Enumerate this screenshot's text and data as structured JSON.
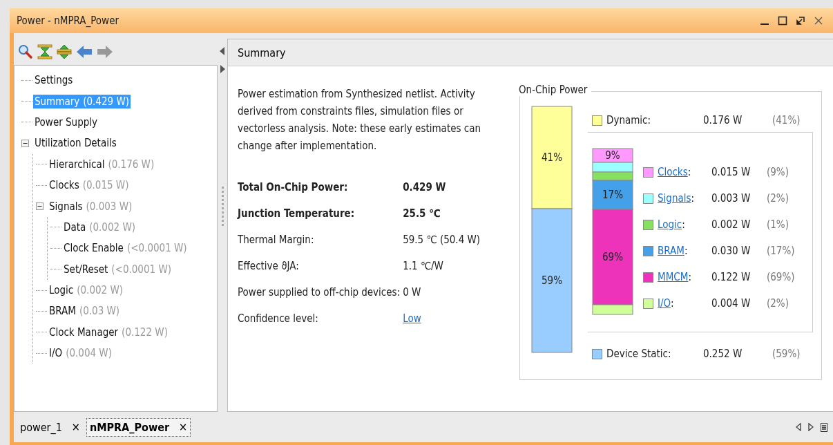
{
  "window": {
    "title": "Power - nMPRA_Power"
  },
  "tree": [
    {
      "label": "Settings",
      "selected": false
    },
    {
      "label": "Summary",
      "value": "(0.429 W)",
      "selected": true
    },
    {
      "label": "Power Supply",
      "selected": false
    },
    {
      "label": "Utilization Details",
      "selected": false,
      "expanded": true,
      "children": [
        {
          "label": "Hierarchical",
          "value": "(0.176 W)",
          "selected": false
        },
        {
          "label": "Clocks",
          "value": "(0.015 W)",
          "selected": false
        },
        {
          "label": "Signals",
          "value": "(0.003 W)",
          "selected": false,
          "expanded": true,
          "children": [
            {
              "label": "Data",
              "value": "(0.002 W)",
              "selected": false
            },
            {
              "label": "Clock Enable",
              "value": "(<0.0001 W)",
              "selected": false
            },
            {
              "label": "Set/Reset",
              "value": "(<0.0001 W)",
              "selected": false
            }
          ]
        },
        {
          "label": "Logic",
          "value": "(0.002 W)",
          "selected": false
        },
        {
          "label": "BRAM",
          "value": "(0.03 W)",
          "selected": false
        },
        {
          "label": "Clock Manager",
          "value": "(0.122 W)",
          "selected": false
        },
        {
          "label": "I/O",
          "value": "(0.004 W)",
          "selected": false
        }
      ]
    }
  ],
  "panel": {
    "title": "Summary",
    "description": "Power estimation from Synthesized netlist. Activity derived from constraints files, simulation files or vectorless analysis. Note: these early estimates can change after implementation.",
    "properties": [
      {
        "label": "Total On-Chip Power:",
        "value": "0.429 W",
        "kind": "bold"
      },
      {
        "label": "Junction Temperature:",
        "value": "25.5 ℃",
        "kind": "bold"
      },
      {
        "label": "Thermal Margin:",
        "value": "59.5 ℃ (50.4 W)",
        "kind": "plain"
      },
      {
        "label": "Effective ϑJA:",
        "value": "1.1 ℃/W",
        "kind": "plain"
      },
      {
        "label": "Power supplied to off-chip devices:",
        "value": "0 W",
        "kind": "plain"
      },
      {
        "label": "Confidence level:",
        "value": "Low",
        "kind": "link"
      }
    ],
    "on_chip_power": {
      "title": "On-Chip Power",
      "share_bar": [
        {
          "label": "41%",
          "color": "#ffff99"
        },
        {
          "label": "59%",
          "color": "#99ccff"
        }
      ],
      "dynamic": {
        "label": "Dynamic:",
        "value": "0.176 W",
        "percent": "(41%)",
        "color": "#ffff99"
      },
      "static": {
        "label": "Device Static:",
        "value": "0.252 W",
        "percent": "(59%)",
        "color": "#99ccff"
      },
      "dynamic_breakdown": {
        "share_bar": [
          {
            "label": "9%",
            "color": "#ff99ff"
          },
          {
            "color": "#99ffff"
          },
          {
            "color": "#88e060"
          },
          {
            "label": "17%",
            "color": "#44a0e8"
          },
          {
            "label": "69%",
            "color": "#ee33bb"
          },
          {
            "color": "#d0ff99"
          }
        ],
        "items": [
          {
            "label": "Clocks",
            "suffix": ":",
            "value": "0.015 W",
            "percent": "(9%)",
            "color": "#ff99ff"
          },
          {
            "label": "Signals",
            "suffix": ":",
            "value": "0.003 W",
            "percent": "(2%)",
            "color": "#99ffff"
          },
          {
            "label": "Logic",
            "suffix": ":",
            "value": "0.002 W",
            "percent": "(1%)",
            "color": "#88e060"
          },
          {
            "label": "BRAM",
            "suffix": ":",
            "value": "0.030 W",
            "percent": "(17%)",
            "color": "#44a0e8"
          },
          {
            "label": "MMCM",
            "suffix": ":",
            "value": "0.122 W",
            "percent": "(69%)",
            "color": "#ee33bb"
          },
          {
            "label": "I/O",
            "suffix": ":",
            "value": "0.004 W",
            "percent": "(2%)",
            "color": "#d0ff99"
          }
        ]
      }
    }
  },
  "bottom_tabs": [
    {
      "label": "power_1",
      "selected": false,
      "close": "✕"
    },
    {
      "label": "nMPRA_Power",
      "selected": true,
      "close": "✕"
    }
  ]
}
